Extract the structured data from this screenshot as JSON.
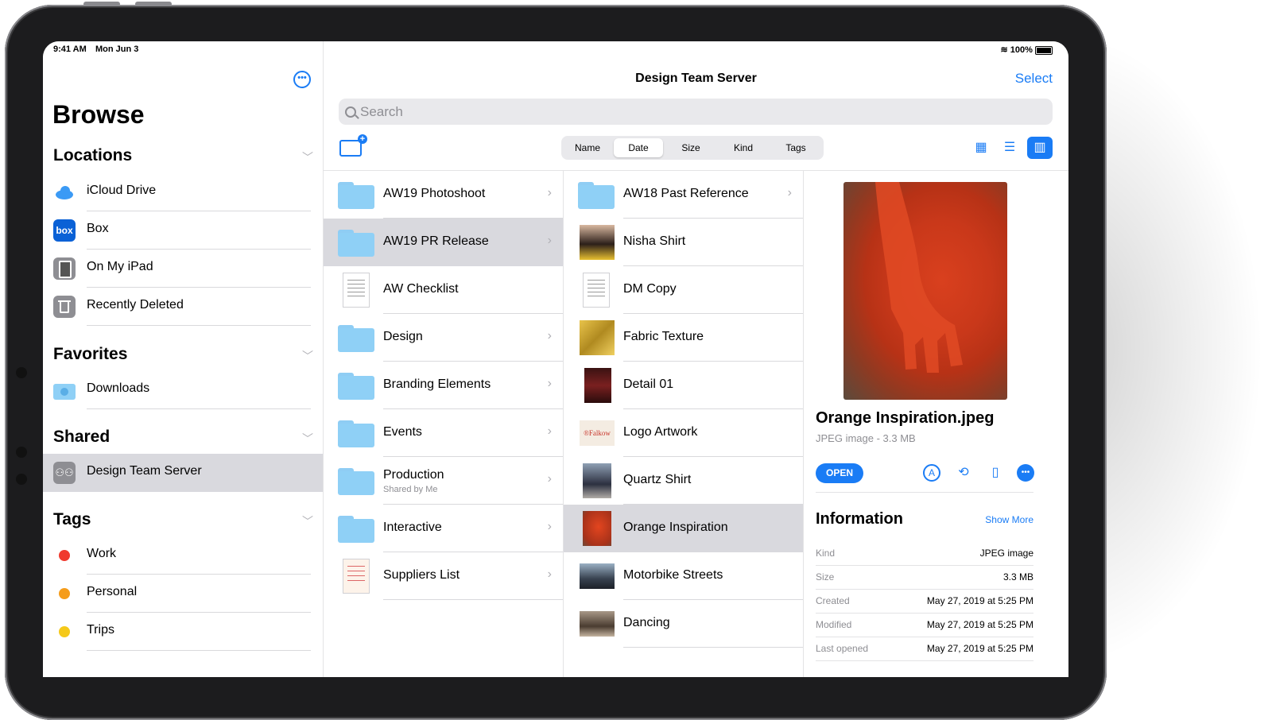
{
  "status_bar": {
    "time": "9:41 AM",
    "date": "Mon Jun 3",
    "battery": "100%"
  },
  "sidebar": {
    "title": "Browse",
    "sections": {
      "locations": {
        "label": "Locations",
        "items": [
          {
            "label": "iCloud Drive",
            "icon": "icloud-icon"
          },
          {
            "label": "Box",
            "icon": "box-icon",
            "icon_text": "box"
          },
          {
            "label": "On My iPad",
            "icon": "ipad-icon"
          },
          {
            "label": "Recently Deleted",
            "icon": "trash-icon"
          }
        ]
      },
      "favorites": {
        "label": "Favorites",
        "items": [
          {
            "label": "Downloads",
            "icon": "downloads-folder-icon"
          }
        ]
      },
      "shared": {
        "label": "Shared",
        "items": [
          {
            "label": "Design Team Server",
            "icon": "server-icon",
            "selected": true
          }
        ]
      },
      "tags": {
        "label": "Tags",
        "items": [
          {
            "label": "Work",
            "color": "#f03a2e"
          },
          {
            "label": "Personal",
            "color": "#f59c1a"
          },
          {
            "label": "Trips",
            "color": "#f5c91a"
          }
        ]
      }
    }
  },
  "main": {
    "title": "Design Team Server",
    "select_label": "Select",
    "search_placeholder": "Search",
    "sort_tabs": [
      {
        "label": "Name"
      },
      {
        "label": "Date",
        "selected": true
      },
      {
        "label": "Size"
      },
      {
        "label": "Kind"
      },
      {
        "label": "Tags"
      }
    ],
    "column1": [
      {
        "name": "AW19 Photoshoot",
        "type": "folder"
      },
      {
        "name": "AW19 PR Release",
        "type": "folder",
        "selected": true
      },
      {
        "name": "AW Checklist",
        "type": "document"
      },
      {
        "name": "Design",
        "type": "shared-folder"
      },
      {
        "name": "Branding Elements",
        "type": "folder"
      },
      {
        "name": "Events",
        "type": "folder"
      },
      {
        "name": "Production",
        "subtitle": "Shared by Me",
        "type": "folder"
      },
      {
        "name": "Interactive",
        "type": "folder"
      },
      {
        "name": "Suppliers List",
        "type": "document"
      }
    ],
    "column2": [
      {
        "name": "AW18 Past Reference",
        "type": "folder"
      },
      {
        "name": "Nisha Shirt",
        "type": "image"
      },
      {
        "name": "DM Copy",
        "type": "document"
      },
      {
        "name": "Fabric Texture",
        "type": "image"
      },
      {
        "name": "Detail 01",
        "type": "image"
      },
      {
        "name": "Logo Artwork",
        "type": "image",
        "thumb_text": "®Falkow"
      },
      {
        "name": "Quartz Shirt",
        "type": "image"
      },
      {
        "name": "Orange Inspiration",
        "type": "image",
        "selected": true
      },
      {
        "name": "Motorbike Streets",
        "type": "image"
      },
      {
        "name": "Dancing",
        "type": "image"
      }
    ]
  },
  "preview": {
    "file_name": "Orange Inspiration.jpeg",
    "file_meta": "JPEG image - 3.3 MB",
    "open_label": "OPEN",
    "info_title": "Information",
    "show_more": "Show More",
    "info": [
      {
        "key": "Kind",
        "value": "JPEG image"
      },
      {
        "key": "Size",
        "value": "3.3 MB"
      },
      {
        "key": "Created",
        "value": "May 27, 2019 at 5:25 PM"
      },
      {
        "key": "Modified",
        "value": "May 27, 2019 at 5:25 PM"
      },
      {
        "key": "Last opened",
        "value": "May 27, 2019 at 5:25 PM"
      }
    ]
  },
  "colors": {
    "accent": "#1a7cf5",
    "folder": "#8fd0f6",
    "selection": "#d9d9de"
  }
}
